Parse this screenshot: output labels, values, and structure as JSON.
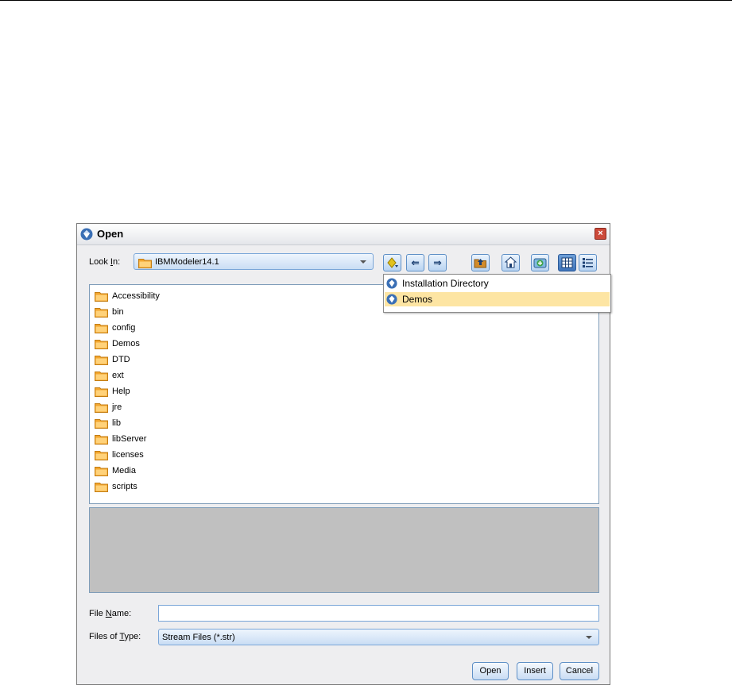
{
  "dialog": {
    "title": "Open",
    "close_label": "×",
    "look_in": {
      "label_pre": "Look ",
      "label_u": "I",
      "label_post": "n:",
      "value": "IBMModeler14.1"
    },
    "toolbar": [
      {
        "name": "favorites-button",
        "glyph": "◆"
      },
      {
        "name": "back-button",
        "glyph": "⇐"
      },
      {
        "name": "forward-button",
        "glyph": "⇒"
      },
      {
        "name": "up-folder-button",
        "glyph": "▲"
      },
      {
        "name": "home-button",
        "glyph": "⌂"
      },
      {
        "name": "new-folder-button",
        "glyph": "+"
      },
      {
        "name": "list-view-button",
        "glyph": "▦"
      },
      {
        "name": "details-view-button",
        "glyph": "☰"
      }
    ],
    "files": [
      "Accessibility",
      "bin",
      "config",
      "Demos",
      "DTD",
      "ext",
      "Help",
      "jre",
      "lib",
      "libServer",
      "licenses",
      "Media",
      "scripts"
    ],
    "file_name": {
      "label_pre": "File ",
      "label_u": "N",
      "label_post": "ame:",
      "value": ""
    },
    "file_type": {
      "label_pre": "Files of ",
      "label_u": "T",
      "label_post": "ype:",
      "value": "Stream Files (*.str)"
    },
    "buttons": {
      "open": "Open",
      "insert": "Insert",
      "cancel": "Cancel"
    }
  },
  "popup": {
    "items": [
      {
        "label": "Installation Directory",
        "selected": false
      },
      {
        "label": "Demos",
        "selected": true
      }
    ]
  },
  "colors": {
    "selection": "#fde5a3",
    "button_border": "#5e8fc6",
    "preview_bg": "#c0c0c0"
  }
}
